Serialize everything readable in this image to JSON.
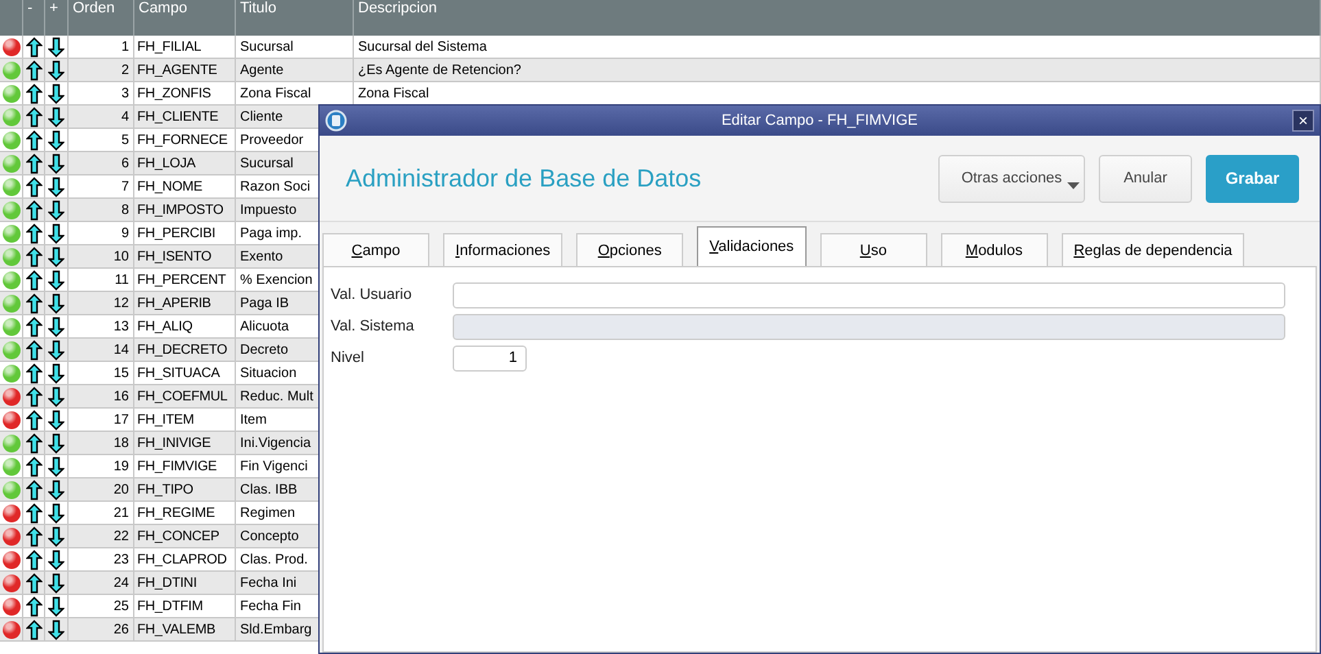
{
  "table": {
    "columns": [
      "-",
      "+",
      "Orden",
      "Campo",
      "Titulo",
      "Descripcion"
    ],
    "rows": [
      {
        "color": "#e02828",
        "orden": "1",
        "campo": "FH_FILIAL",
        "titulo": "Sucursal",
        "descripcion": "Sucursal del Sistema"
      },
      {
        "color": "#62c83a",
        "orden": "2",
        "campo": "FH_AGENTE",
        "titulo": "Agente",
        "descripcion": "¿Es Agente de Retencion?"
      },
      {
        "color": "#62c83a",
        "orden": "3",
        "campo": "FH_ZONFIS",
        "titulo": "Zona Fiscal",
        "descripcion": "Zona Fiscal"
      },
      {
        "color": "#62c83a",
        "orden": "4",
        "campo": "FH_CLIENTE",
        "titulo": "Cliente"
      },
      {
        "color": "#62c83a",
        "orden": "5",
        "campo": "FH_FORNECE",
        "titulo": "Proveedor"
      },
      {
        "color": "#62c83a",
        "orden": "6",
        "campo": "FH_LOJA",
        "titulo": "Sucursal"
      },
      {
        "color": "#62c83a",
        "orden": "7",
        "campo": "FH_NOME",
        "titulo": "Razon Soci"
      },
      {
        "color": "#62c83a",
        "orden": "8",
        "campo": "FH_IMPOSTO",
        "titulo": "Impuesto"
      },
      {
        "color": "#62c83a",
        "orden": "9",
        "campo": "FH_PERCIBI",
        "titulo": "Paga imp."
      },
      {
        "color": "#62c83a",
        "orden": "10",
        "campo": "FH_ISENTO",
        "titulo": "Exento"
      },
      {
        "color": "#62c83a",
        "orden": "11",
        "campo": "FH_PERCENT",
        "titulo": "% Exencion"
      },
      {
        "color": "#62c83a",
        "orden": "12",
        "campo": "FH_APERIB",
        "titulo": "Paga IB"
      },
      {
        "color": "#62c83a",
        "orden": "13",
        "campo": "FH_ALIQ",
        "titulo": "Alicuota"
      },
      {
        "color": "#62c83a",
        "orden": "14",
        "campo": "FH_DECRETO",
        "titulo": "Decreto"
      },
      {
        "color": "#62c83a",
        "orden": "15",
        "campo": "FH_SITUACA",
        "titulo": "Situacion"
      },
      {
        "color": "#e02828",
        "orden": "16",
        "campo": "FH_COEFMUL",
        "titulo": "Reduc. Mult"
      },
      {
        "color": "#e02828",
        "orden": "17",
        "campo": "FH_ITEM",
        "titulo": "Item"
      },
      {
        "color": "#62c83a",
        "orden": "18",
        "campo": "FH_INIVIGE",
        "titulo": "Ini.Vigencia"
      },
      {
        "color": "#62c83a",
        "orden": "19",
        "campo": "FH_FIMVIGE",
        "titulo": "Fin Vigenci"
      },
      {
        "color": "#62c83a",
        "orden": "20",
        "campo": "FH_TIPO",
        "titulo": "Clas. IBB"
      },
      {
        "color": "#e02828",
        "orden": "21",
        "campo": "FH_REGIME",
        "titulo": "Regimen"
      },
      {
        "color": "#e02828",
        "orden": "22",
        "campo": "FH_CONCEP",
        "titulo": "Concepto"
      },
      {
        "color": "#e02828",
        "orden": "23",
        "campo": "FH_CLAPROD",
        "titulo": "Clas. Prod."
      },
      {
        "color": "#e02828",
        "orden": "24",
        "campo": "FH_DTINI",
        "titulo": "Fecha Ini"
      },
      {
        "color": "#e02828",
        "orden": "25",
        "campo": "FH_DTFIM",
        "titulo": "Fecha Fin"
      },
      {
        "color": "#e02828",
        "orden": "26",
        "campo": "FH_VALEMB",
        "titulo": "Sld.Embarg"
      }
    ]
  },
  "dialog": {
    "title": "Editar Campo - FH_FIMVIGE",
    "close": "×",
    "heading": "Administrador de Base de Datos",
    "buttons": [
      {
        "label": "Otras acciones",
        "kind": "menu"
      },
      {
        "label": "Anular",
        "kind": "plain"
      },
      {
        "label": "Grabar",
        "kind": "primary"
      }
    ],
    "tabs": [
      {
        "mnemonic": "C",
        "rest": "ampo",
        "selected": false
      },
      {
        "mnemonic": "I",
        "rest": "nformaciones",
        "selected": false
      },
      {
        "mnemonic": "O",
        "rest": "pciones",
        "selected": false
      },
      {
        "mnemonic": "V",
        "rest": "alidaciones",
        "selected": true
      },
      {
        "mnemonic": "U",
        "rest": "so",
        "selected": false
      },
      {
        "mnemonic": "M",
        "rest": "odulos",
        "selected": false
      },
      {
        "mnemonic": "R",
        "rest": "eglas de dependencia",
        "selected": false
      }
    ],
    "fields": [
      {
        "label": "Val. Usuario",
        "kind": "wide",
        "disabled": false
      },
      {
        "label": "Val. Sistema",
        "kind": "wide",
        "disabled": true
      },
      {
        "label": "Nivel",
        "kind": "number",
        "value": "1",
        "disabled": false
      }
    ]
  }
}
